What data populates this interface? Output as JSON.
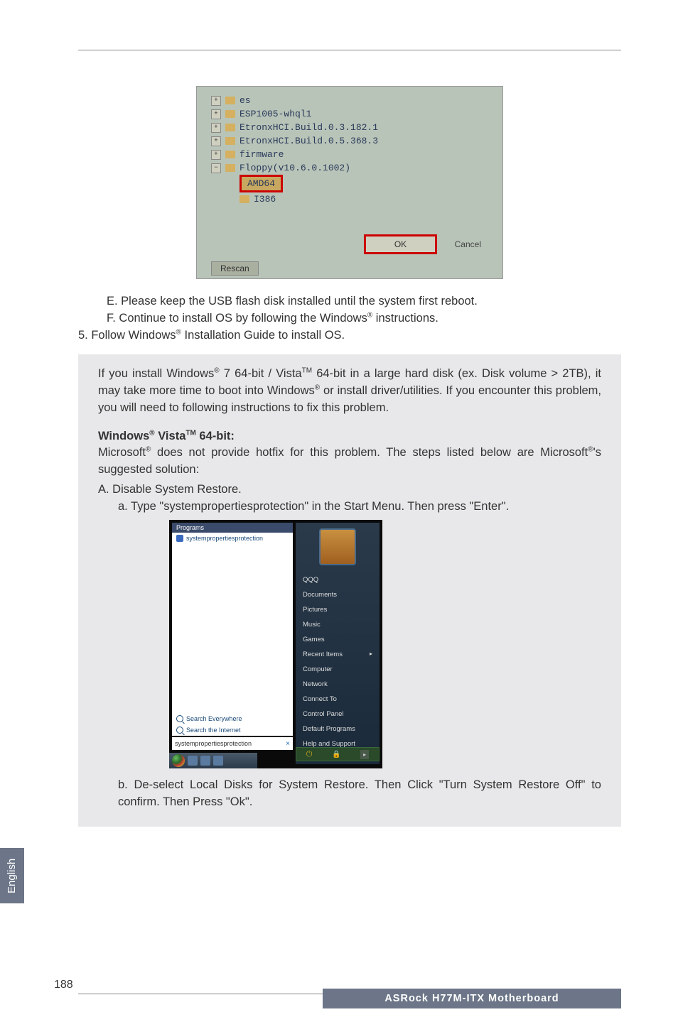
{
  "screenshot1": {
    "tree": [
      {
        "icon": "+",
        "label": "es"
      },
      {
        "icon": "+",
        "label": "ESP1005-whql1"
      },
      {
        "icon": "+",
        "label": "EtronxHCI.Build.0.3.182.1"
      },
      {
        "icon": "+",
        "label": "EtronxHCI.Build.0.5.368.3"
      },
      {
        "icon": "+",
        "label": "firmware"
      },
      {
        "icon": "-",
        "label": "Floppy(v10.6.0.1002)"
      }
    ],
    "amd_label": "AMD64",
    "i386_label": "I386",
    "ok": "OK",
    "cancel": "Cancel",
    "rescan": "Rescan"
  },
  "instructions": {
    "step_e": "E. Please keep the USB flash disk installed until the system first reboot.",
    "step_f_prefix": "F. Continue to install OS by following the Windows",
    "step_f_suffix": " instructions.",
    "step_5_prefix": "5. Follow Windows",
    "step_5_suffix": " Installation Guide to install OS."
  },
  "note": {
    "p1_a": "If you install Windows",
    "p1_b": " 7 64-bit / Vista",
    "p1_c": " 64-bit in a large hard disk (ex. Disk volume > 2TB), it may take more time to boot into Windows",
    "p1_d": " or install driver/utilities. If you encounter this problem, you will need to following instructions to fix this problem.",
    "heading_a": "Windows",
    "heading_b": " Vista",
    "heading_c": " 64-bit:",
    "p2_a": "Microsoft",
    "p2_b": " does not provide hotfix for this problem. The steps listed below are Microsoft",
    "p2_c": "'s suggested solution:",
    "step_A": "A. Disable System Restore.",
    "step_a": "a. Type \"systempropertiesprotection\" in the Start Menu. Then press \"Enter\".",
    "step_b": "b. De-select Local Disks for System Restore. Then Click \"Turn System Restore Off\" to confirm. Then Press \"Ok\"."
  },
  "startmenu": {
    "programs_header": "Programs",
    "program_item": "systempropertiesprotection",
    "search_everywhere": "Search Everywhere",
    "search_internet": "Search the Internet",
    "search_value": "systempropertiesprotection",
    "user": "QQQ",
    "right_items": [
      "Documents",
      "Pictures",
      "Music",
      "Games",
      "Recent Items",
      "Computer",
      "Network",
      "Connect To",
      "Control Panel",
      "Default Programs",
      "Help and Support"
    ]
  },
  "side_tab": "English",
  "page_number": "188",
  "footer": "ASRock  H77M-ITX  Motherboard",
  "reg": "®",
  "tm": "TM"
}
